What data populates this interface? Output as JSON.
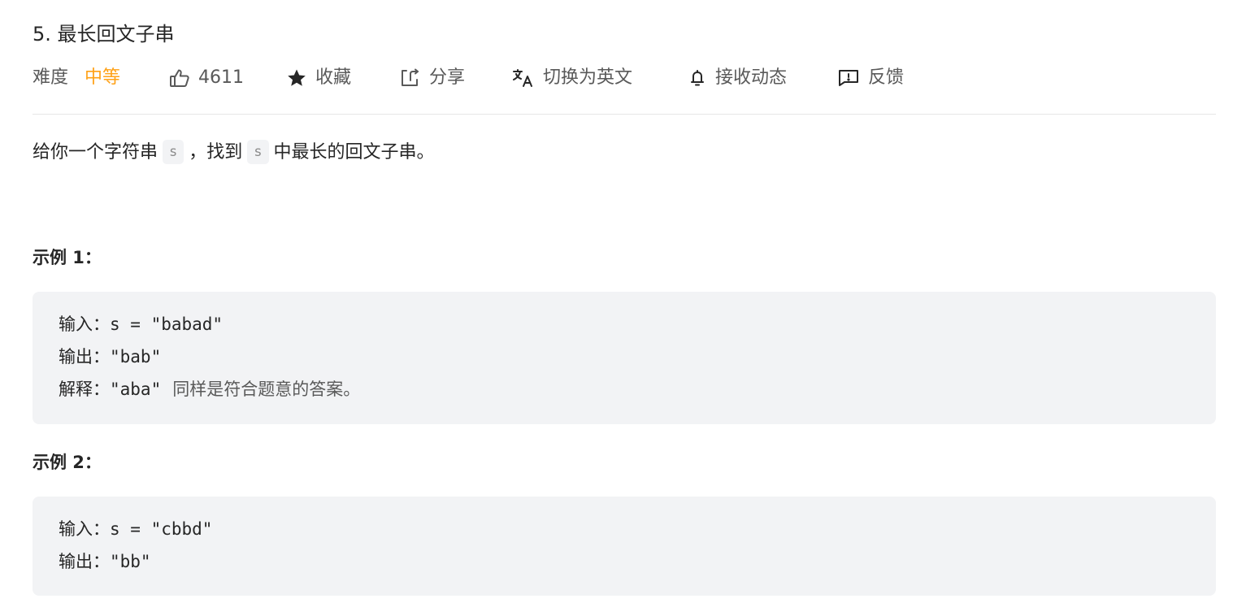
{
  "problem": {
    "title": "5. 最长回文子串"
  },
  "meta": {
    "difficulty_label": "难度",
    "difficulty_value": "中等",
    "likes": "4611",
    "favorite_label": "收藏",
    "share_label": "分享",
    "translate_label": "切换为英文",
    "subscribe_label": "接收动态",
    "feedback_label": "反馈",
    "difficulty_color": "#ffa116"
  },
  "description": {
    "part1": "给你一个字符串",
    "code1": "s",
    "part2": "，找到",
    "code2": "s",
    "part3": "中最长的回文子串。"
  },
  "examples": [
    {
      "title": "示例 1：",
      "input_label": "输入：",
      "input_value": "s = \"babad\"",
      "output_label": "输出：",
      "output_value": "\"bab\"",
      "explanation_label": "解释：",
      "explanation_code": "\"aba\"",
      "explanation_text": "同样是符合题意的答案。"
    },
    {
      "title": "示例 2：",
      "input_label": "输入：",
      "input_value": "s = \"cbbd\"",
      "output_label": "输出：",
      "output_value": "\"bb\""
    }
  ],
  "icons": {
    "like": "thumbs-up-icon",
    "favorite": "star-icon",
    "share": "share-icon",
    "translate": "translate-icon",
    "subscribe": "bell-icon",
    "feedback": "feedback-icon"
  }
}
